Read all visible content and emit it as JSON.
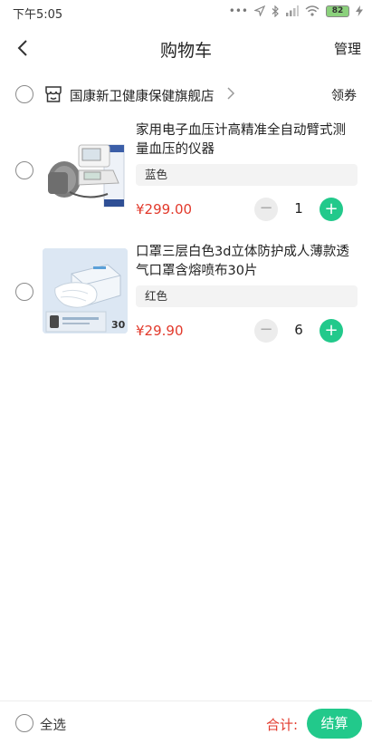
{
  "status_bar": {
    "time": "下午5:05",
    "battery": "82"
  },
  "nav": {
    "title": "购物车",
    "manage_label": "管理"
  },
  "shop": {
    "name": "国康新卫健康保健旗舰店",
    "coupon_label": "领券"
  },
  "cart_items": [
    {
      "title": "家用电子血压计高精准全自动臂式测量血压的仪器",
      "variant": "蓝色",
      "price": "¥299.00",
      "quantity": "1"
    },
    {
      "title": "口罩三层白色3d立体防护成人薄款透气口罩含熔喷布30片",
      "variant": "红色",
      "price": "¥29.90",
      "quantity": "6"
    }
  ],
  "product_thumbs": {
    "mask_badge": "30"
  },
  "buttons": {
    "minus": "−",
    "plus": "+"
  },
  "footer": {
    "select_all_label": "全选",
    "total_label": "合计:",
    "checkout_label": "结算"
  },
  "colors": {
    "accent": "#22c98b",
    "price": "#e23a2c"
  }
}
